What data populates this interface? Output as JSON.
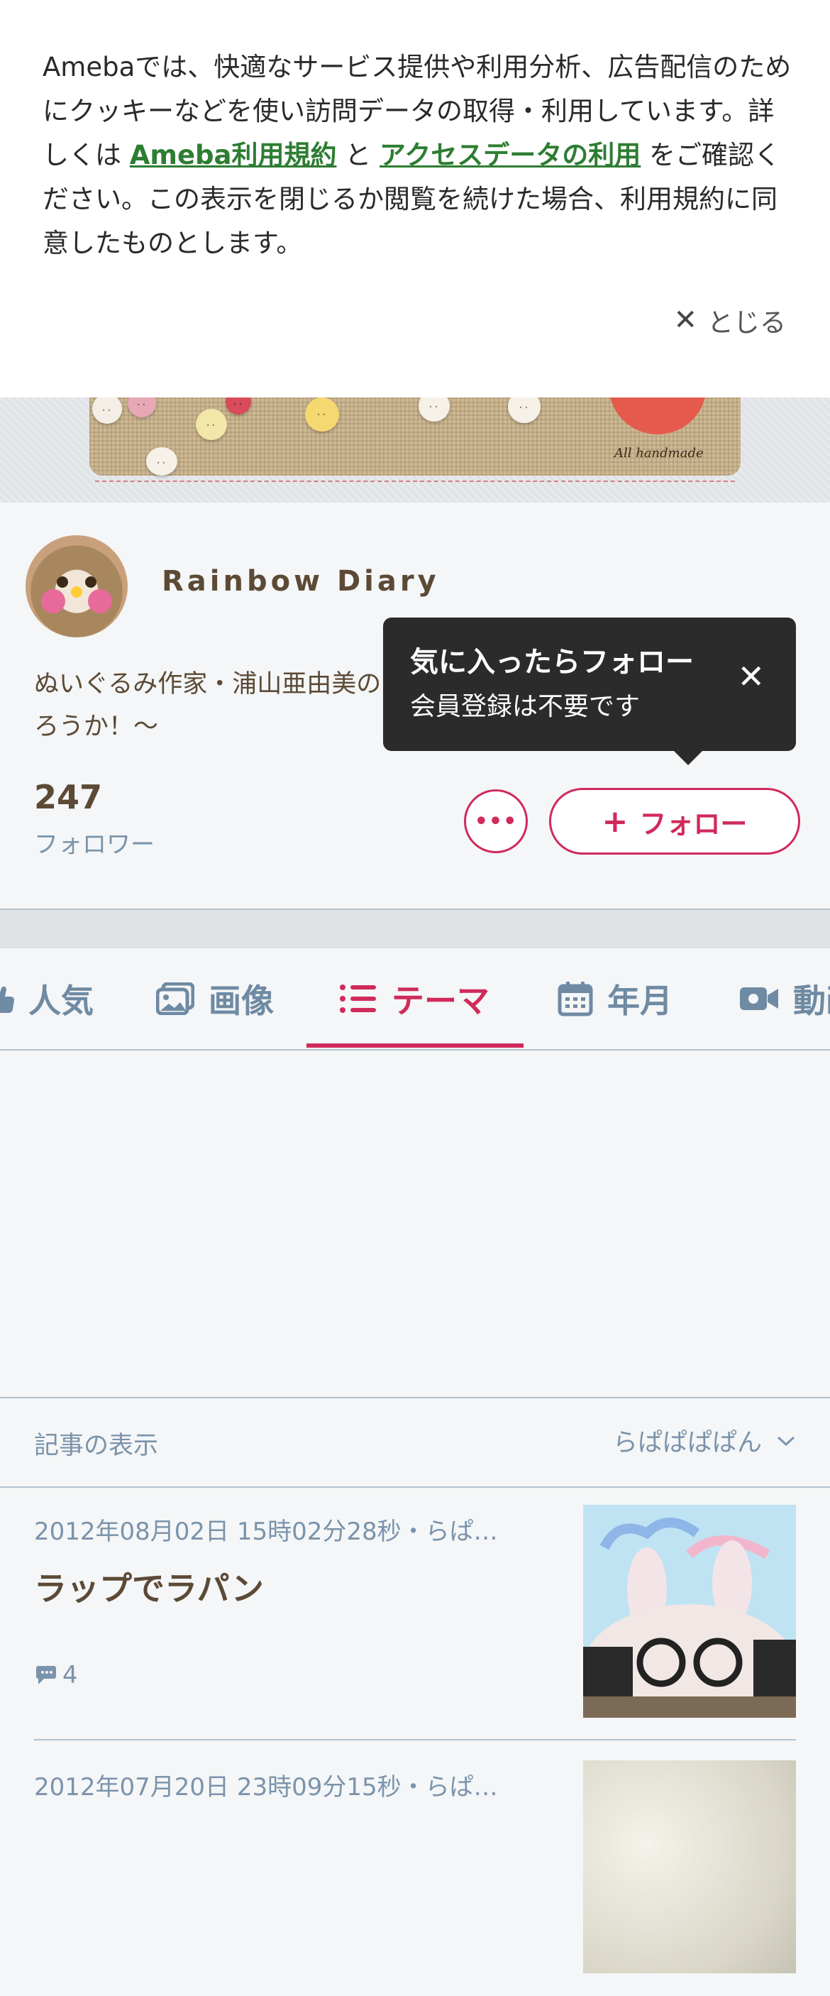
{
  "cookie_banner": {
    "text_1": "Amebaでは、快適なサービス提供や利用分析、広告配信のためにクッキーなどを使い訪問データの取得・利用しています。詳しくは ",
    "link_terms": "Ameba利用規約",
    "text_2": " と ",
    "link_access_data": "アクセスデータの利用",
    "text_3": " をご確認ください。この表示を閉じるか閲覧を続けた場合、利用規約に同意したものとします。",
    "close_label": "とじる",
    "link_color": "#2e7d32"
  },
  "header": {
    "stamp_label": "All handmade"
  },
  "profile": {
    "blog_title": "Rainbow Diary",
    "description": "ぬいぐるみ作家・浦山亜由美の",
    "description_line2": "ろうか！〜",
    "follower_count": "247",
    "follower_label": "フォロワー",
    "more_label": "•••",
    "follow_label": "フォロー",
    "accent_color": "#d02a5b"
  },
  "tooltip": {
    "title": "気に入ったらフォロー",
    "subtitle": "会員登録は不要です"
  },
  "tabs": [
    {
      "label": "人気",
      "icon": "popular-icon",
      "active": false
    },
    {
      "label": "画像",
      "icon": "image-icon",
      "active": false
    },
    {
      "label": "テーマ",
      "icon": "list-icon",
      "active": true
    },
    {
      "label": "年月",
      "icon": "calendar-icon",
      "active": false
    },
    {
      "label": "動画",
      "icon": "video-icon",
      "active": false
    }
  ],
  "sort": {
    "label": "記事の表示",
    "value": "らぱぱぱぱん"
  },
  "articles": [
    {
      "date": "2012年08月02日 15時02分28秒・らぱ…",
      "title": "ラップでラパン",
      "comments": "4"
    },
    {
      "date": "2012年07月20日 23時09分15秒・らぱ…",
      "title": "",
      "comments": ""
    }
  ]
}
